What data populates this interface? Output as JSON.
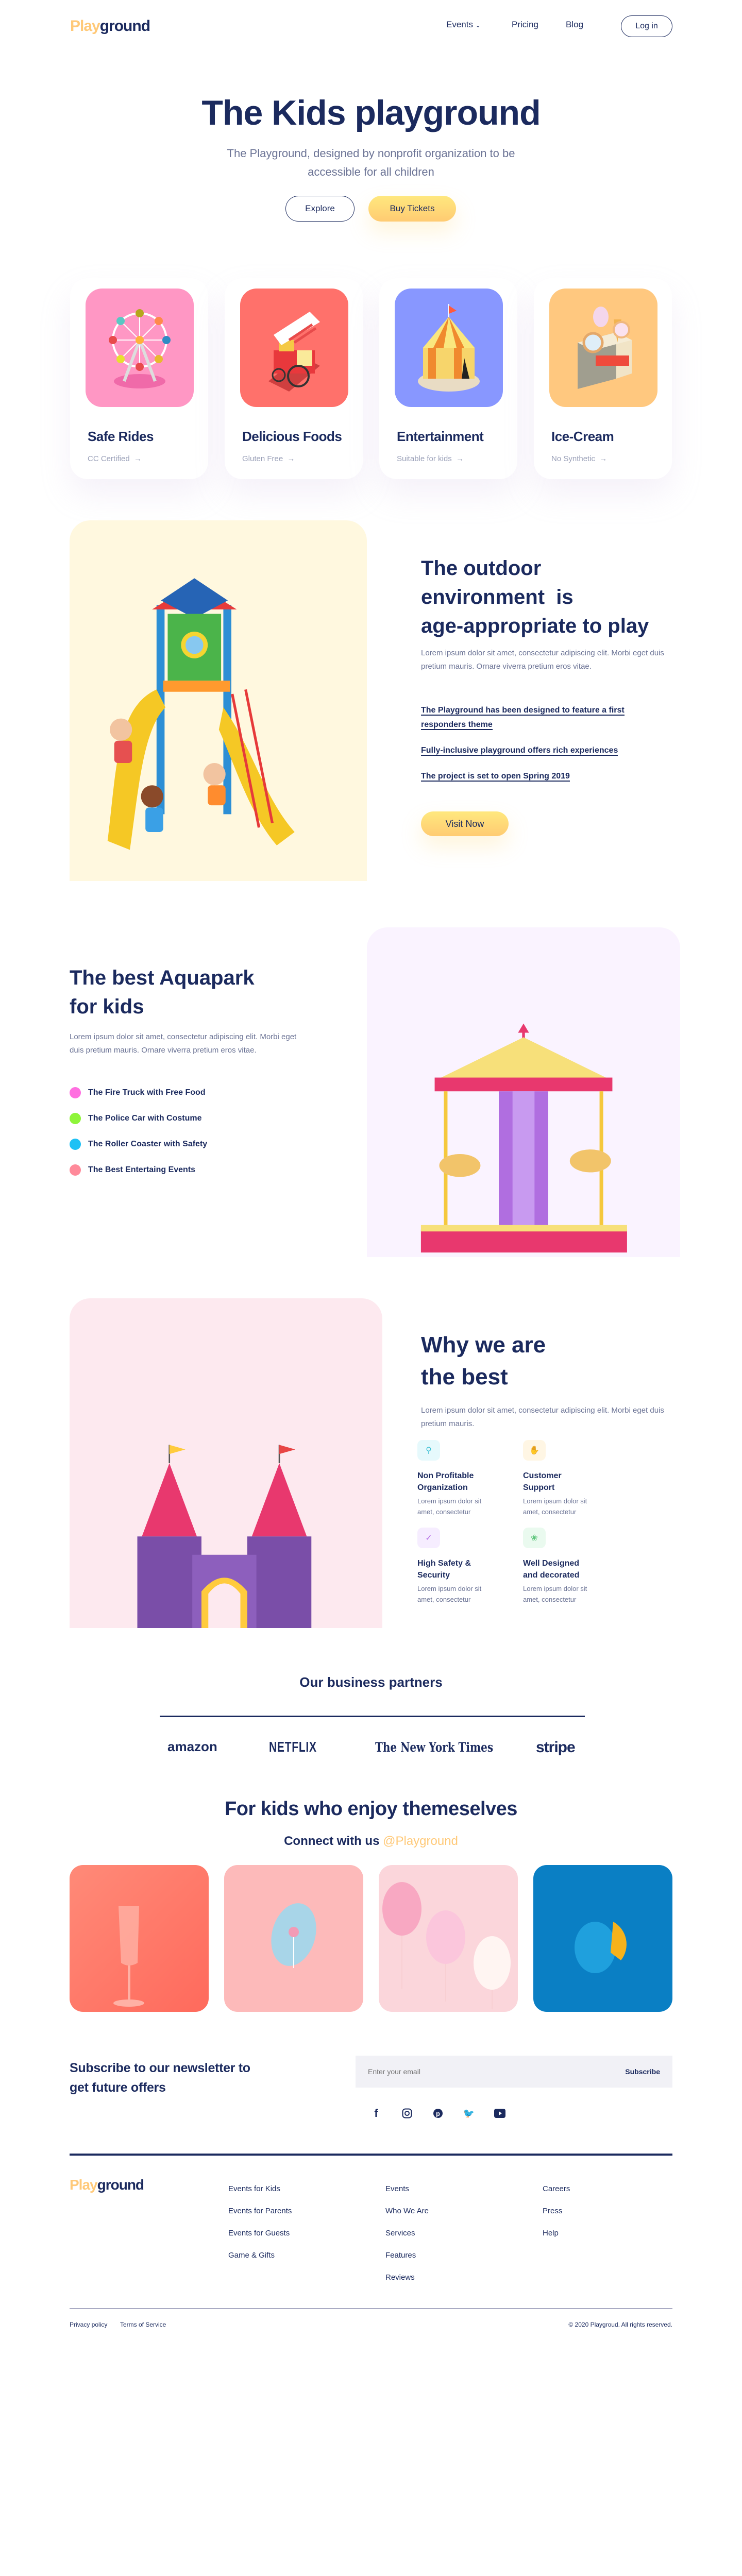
{
  "brand": {
    "logo_part1": "Play",
    "logo_part2": "ground",
    "accent": "#ffc978",
    "navy": "#1b2a5e"
  },
  "nav": {
    "items": [
      {
        "label": "Events",
        "icon": "chevron-down-icon"
      },
      {
        "label": "Pricing"
      },
      {
        "label": "Blog"
      }
    ],
    "login": "Log in"
  },
  "hero": {
    "title": "The Kids playground",
    "subtitle_line1": "The Playground, designed by nonprofit organization to be",
    "subtitle_line2": "accessible for all children",
    "explore": "Explore",
    "buy": "Buy Tickets"
  },
  "cards": [
    {
      "title": "Safe Rides",
      "sub": "CC Certified",
      "color": "#ff97c4",
      "icon": "ferris-wheel-icon"
    },
    {
      "title": "Delicious Foods",
      "sub": "Gluten Free",
      "color": "#ff716b",
      "icon": "food-cart-icon"
    },
    {
      "title": "Entertainment",
      "sub": "Suitable for kids",
      "color": "#8897ff",
      "icon": "circus-tent-icon"
    },
    {
      "title": "Ice-Cream",
      "sub": "No Synthetic",
      "color": "#ffc87f",
      "icon": "ice-cream-stand-icon"
    }
  ],
  "outdoor": {
    "title_line1": "The outdoor",
    "title_line2": "environment  is",
    "title_line3": "age-appropriate to play",
    "body": "Lorem ipsum dolor sit amet, consectetur adipiscing elit. Morbi eget duis pretium mauris. Ornare viverra pretium eros vitae.",
    "links": [
      "The Playground has been designed to feature a first responders theme",
      "Fully-inclusive playground offers rich experiences",
      "The project is set to open Spring 2019"
    ],
    "button": "Visit Now"
  },
  "aquapark": {
    "title_line1": "The best Aquapark",
    "title_line2": "for kids",
    "body": "Lorem ipsum dolor sit amet, consectetur adipiscing elit. Morbi eget duis pretium mauris. Ornare viverra pretium eros vitae.",
    "items": [
      {
        "label": "The Fire Truck with Free Food",
        "color": "#ff6fe0"
      },
      {
        "label": "The Police Car with Costume",
        "color": "#8ef53a"
      },
      {
        "label": "The Roller Coaster with Safety",
        "color": "#1ec1f5"
      },
      {
        "label": "The Best Entertaing Events",
        "color": "#ff8a9a"
      }
    ]
  },
  "why": {
    "title_line1": "Why we are",
    "title_line2": "the best",
    "body": "Lorem ipsum dolor sit amet, consectetur adipiscing elit. Morbi eget duis pretium mauris.",
    "features": [
      {
        "title_line1": "Non Profitable",
        "title_line2": "Organization",
        "desc_line1": "Lorem ipsum dolor sit",
        "desc_line2": "amet, consectetur",
        "icon": "money-jar-icon",
        "bg": "#e6f9fc",
        "fg": "#3fc0d3"
      },
      {
        "title_line1": "Customer",
        "title_line2": "Support",
        "desc_line1": "Lorem ipsum dolor sit",
        "desc_line2": "amet, consectetur",
        "icon": "handshake-icon",
        "bg": "#fff6e4",
        "fg": "#ffb938"
      },
      {
        "title_line1": "High Safety &",
        "title_line2": "Security",
        "desc_line1": "Lorem ipsum dolor sit",
        "desc_line2": "amet, consectetur",
        "icon": "shield-check-icon",
        "bg": "#f6edff",
        "fg": "#b46ae6"
      },
      {
        "title_line1": "Well Designed",
        "title_line2": "and decorated",
        "desc_line1": "Lorem ipsum dolor sit",
        "desc_line2": "amet, consectetur",
        "icon": "brushes-icon",
        "bg": "#eafaef",
        "fg": "#5cc47a"
      }
    ]
  },
  "partners": {
    "title": "Our business partners",
    "logos": [
      "amazon",
      "NETFLIX",
      "The New York Times",
      "stripe"
    ]
  },
  "social_gallery": {
    "title": "For kids who enjoy themeselves",
    "connect": "Connect with us",
    "handle": "@Playground"
  },
  "newsletter": {
    "title_line1": "Subscribe to our newsletter to",
    "title_line2": "get future offers",
    "placeholder": "Enter your email",
    "button": "Subscribe",
    "social": [
      "facebook-icon",
      "instagram-icon",
      "pinterest-icon",
      "twitter-icon",
      "youtube-icon"
    ]
  },
  "footer": {
    "col1": [
      "Events for Kids",
      "Events for Parents",
      "Events for Guests",
      "Game & Gifts"
    ],
    "col2": [
      "Events",
      "Who We Are",
      "Services",
      "Features",
      "Reviews"
    ],
    "col3": [
      "Careers",
      "Press",
      "Help"
    ],
    "privacy": "Privacy policy",
    "terms": "Terms of Service",
    "copyright": "© 2020 Playgroud. All rights reserved."
  }
}
